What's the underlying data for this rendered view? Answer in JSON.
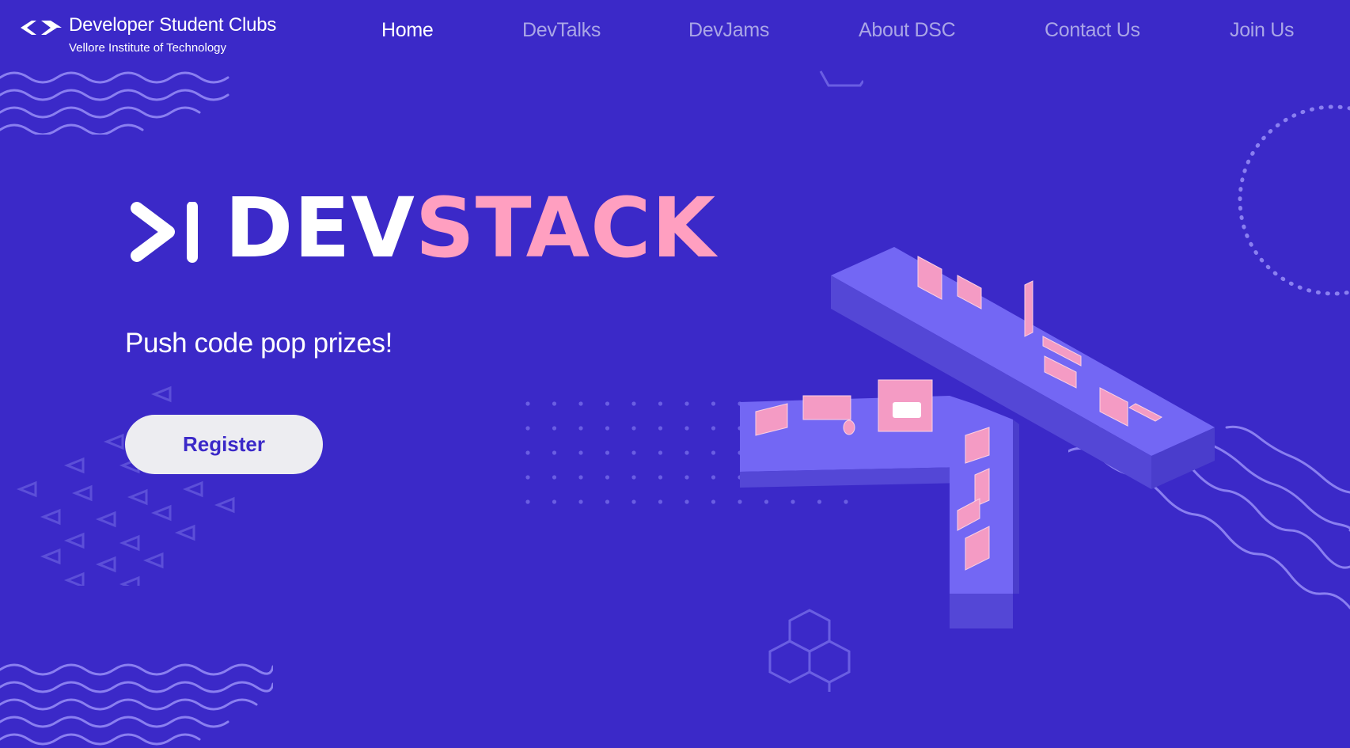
{
  "brand": {
    "title": "Developer Student Clubs",
    "subtitle": "Vellore Institute of Technology",
    "icon": "code-brackets-icon"
  },
  "nav": {
    "items": [
      {
        "label": "Home",
        "active": true
      },
      {
        "label": "DevTalks",
        "active": false
      },
      {
        "label": "DevJams",
        "active": false
      },
      {
        "label": "About DSC",
        "active": false
      },
      {
        "label": "Contact Us",
        "active": false
      },
      {
        "label": "Join Us",
        "active": false
      }
    ]
  },
  "hero": {
    "wordmark_part1": "DEV",
    "wordmark_part2": "STACK",
    "logo_icon": "terminal-prompt-icon",
    "tagline": "Push code pop prizes!",
    "register_label": "Register"
  },
  "colors": {
    "background": "#3b29c8",
    "accent_pink": "#ff9fc0",
    "nav_inactive": "#aaa6e6",
    "button_bg": "#ededf1",
    "illustration_desk": "#6b5ef0"
  }
}
